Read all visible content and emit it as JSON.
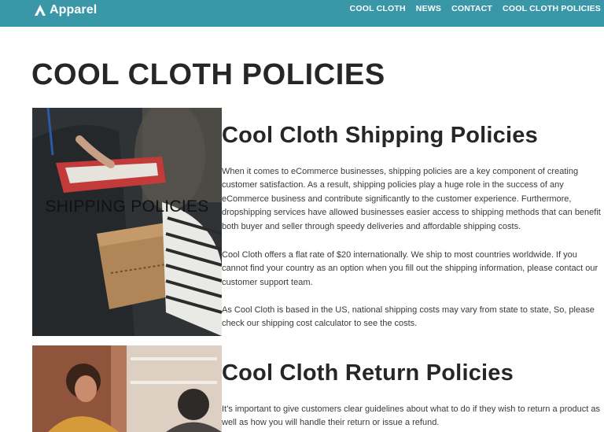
{
  "header": {
    "brand": "Apparel",
    "nav": [
      "COOL CLOTH",
      "NEWS",
      "CONTACT",
      "COOL CLOTH POLICIES"
    ]
  },
  "page": {
    "title": "COOL CLOTH POLICIES"
  },
  "shipping": {
    "image_label": "SHIPPING POLICIES",
    "heading": "Cool Cloth Shipping Policies",
    "paragraphs": [
      "When it comes to eCommerce businesses, shipping policies are a key component of creating customer satisfaction. As a result, shipping policies play a huge role in the success of any eCommerce business and contribute significantly to the customer experience. Furthermore, dropshipping services have allowed businesses easier access to shipping methods that can benefit both buyer and seller through speedy deliveries and affordable shipping costs.",
      "Cool Cloth offers a flat rate of $20 internationally. We ship to most countries worldwide. If you cannot find your country as an option when you fill out the shipping information, please contact our customer support team.",
      "As Cool Cloth is based in the US, national shipping costs may vary from state to state, So, please check our shipping cost calculator to see the costs."
    ]
  },
  "returns": {
    "heading": "Cool Cloth Return Policies",
    "paragraphs": [
      "It’s important to give customers clear guidelines about what to do if they wish to return a product as well as how you will handle their return or issue a refund."
    ]
  },
  "colors": {
    "header_bg": "#3a97a8",
    "text": "#262626"
  }
}
